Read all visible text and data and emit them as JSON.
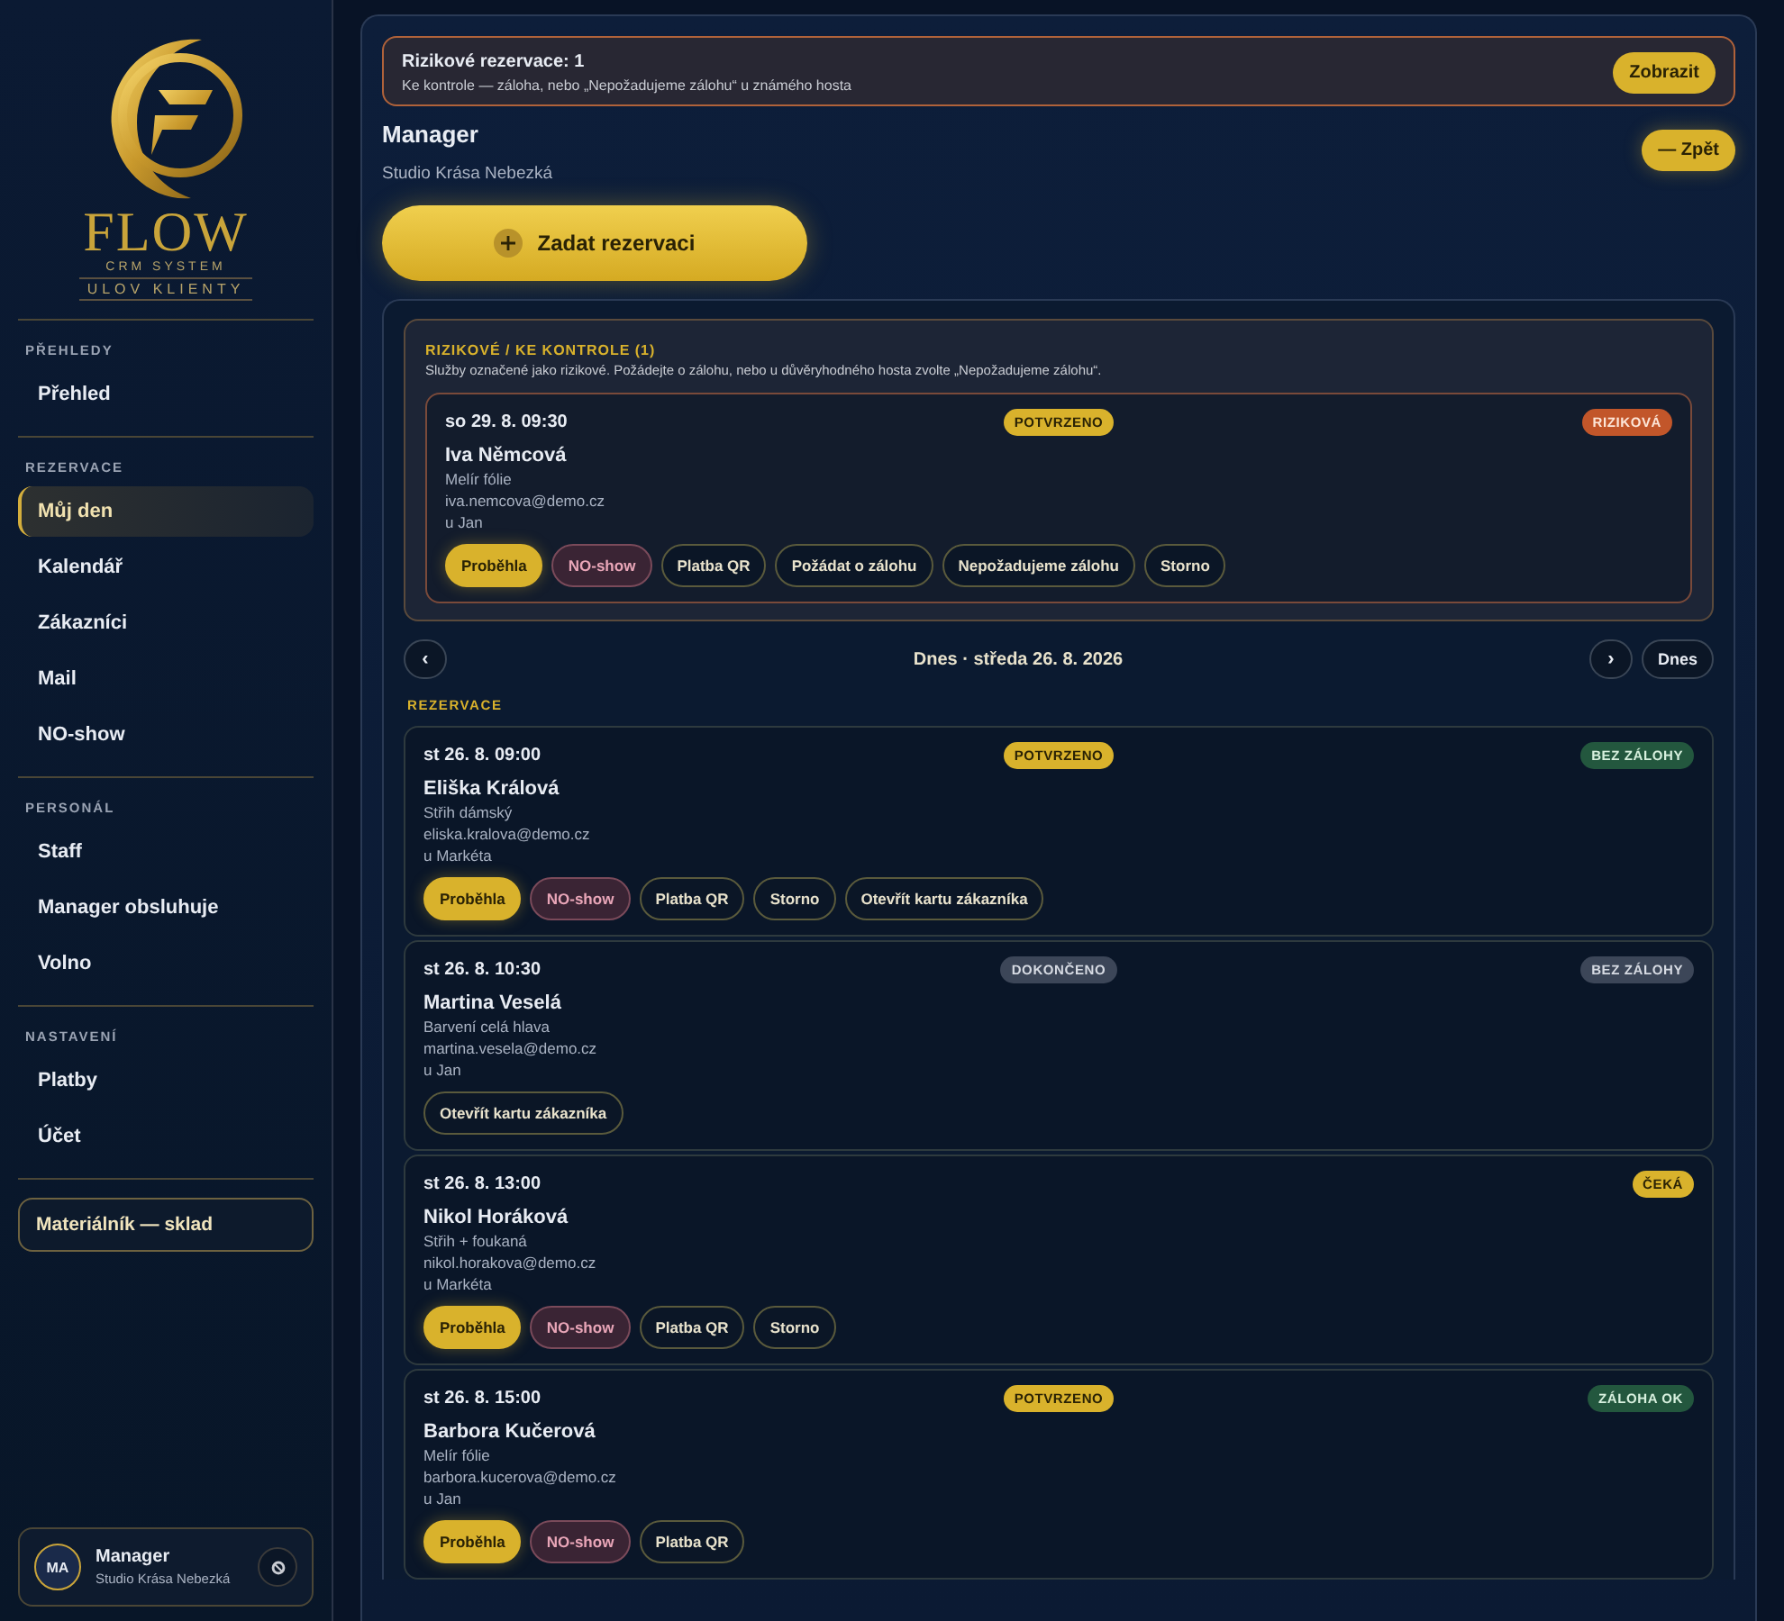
{
  "sidebar": {
    "logo": {
      "title": "FLOW",
      "subtitle": "CRM SYSTEM",
      "tagline": "ULOV KLIENTY"
    },
    "sections": [
      {
        "heading": "PŘEHLEDY",
        "items": [
          {
            "label": "Přehled",
            "selected": false
          }
        ]
      },
      {
        "heading": "REZERVACE",
        "items": [
          {
            "label": "Můj den",
            "selected": true
          },
          {
            "label": "Kalendář",
            "selected": false
          },
          {
            "label": "Zákazníci",
            "selected": false
          },
          {
            "label": "Mail",
            "selected": false
          },
          {
            "label": "NO-show",
            "selected": false
          }
        ]
      },
      {
        "heading": "PERSONÁL",
        "items": [
          {
            "label": "Staff",
            "selected": false
          },
          {
            "label": "Manager obsluhuje",
            "selected": false
          },
          {
            "label": "Volno",
            "selected": false
          }
        ]
      },
      {
        "heading": "NASTAVENÍ",
        "items": [
          {
            "label": "Platby",
            "selected": false
          },
          {
            "label": "Účet",
            "selected": false
          }
        ]
      }
    ],
    "footer_button": "Materiálník — sklad",
    "user": {
      "initials": "MA",
      "name": "Manager",
      "studio": "Studio Krása Nebezká"
    }
  },
  "main": {
    "alert": {
      "title": "Rizikové rezervace: 1",
      "text": "Ke kontrole — záloha, nebo „Nepožadujeme zálohu“ u známého hosta",
      "button": "Zobrazit"
    },
    "header": {
      "title": "Manager",
      "subtitle": "Studio Krása Nebezká",
      "back_button": "— Zpět"
    },
    "add_button": "Zadat rezervaci",
    "risky": {
      "heading": "RIZIKOVÉ / KE KONTROLE (1)",
      "text": "Služby označené jako rizikové. Požádejte o zálohu, nebo u důvěryhodného hosta zvolte „Nepožadujeme zálohu“.",
      "bookings": [
        {
          "datetime": "so 29. 8. 09:30",
          "status": {
            "label": "POTVRZENO",
            "kind": "confirmed"
          },
          "tag": {
            "label": "RIZIKOVÁ",
            "kind": "risk"
          },
          "name": "Iva Němcová",
          "service": "Melír fólie",
          "email": "iva.nemcova@demo.cz",
          "staff": "u Jan",
          "actions": [
            {
              "label": "Proběhla",
              "kind": "primary"
            },
            {
              "label": "NO-show",
              "kind": "danger"
            },
            {
              "label": "Platba QR",
              "kind": "outline"
            },
            {
              "label": "Požádat o zálohu",
              "kind": "outline"
            },
            {
              "label": "Nepožadujeme zálohu",
              "kind": "outline"
            },
            {
              "label": "Storno",
              "kind": "outline"
            }
          ]
        }
      ]
    },
    "date_nav": {
      "prev": "‹",
      "label": "Dnes · středa 26. 8. 2026",
      "next": "›",
      "today": "Dnes"
    },
    "section_label": "REZERVACE",
    "bookings": [
      {
        "datetime": "st 26. 8. 09:00",
        "status": {
          "label": "POTVRZENO",
          "kind": "confirmed"
        },
        "tag": {
          "label": "BEZ ZÁLOHY",
          "kind": "ok"
        },
        "name": "Eliška Králová",
        "service": "Střih dámský",
        "email": "eliska.kralova@demo.cz",
        "staff": "u Markéta",
        "actions": [
          {
            "label": "Proběhla",
            "kind": "primary"
          },
          {
            "label": "NO-show",
            "kind": "danger"
          },
          {
            "label": "Platba QR",
            "kind": "outline"
          },
          {
            "label": "Storno",
            "kind": "outline"
          },
          {
            "label": "Otevřít kartu zákazníka",
            "kind": "outline"
          }
        ]
      },
      {
        "datetime": "st 26. 8. 10:30",
        "status": {
          "label": "DOKONČENO",
          "kind": "done"
        },
        "tag": {
          "label": "BEZ ZÁLOHY",
          "kind": "muted"
        },
        "name": "Martina Veselá",
        "service": "Barvení celá hlava",
        "email": "martina.vesela@demo.cz",
        "staff": "u Jan",
        "actions": [
          {
            "label": "Otevřít kartu zákazníka",
            "kind": "outline"
          }
        ]
      },
      {
        "datetime": "st 26. 8. 13:00",
        "tag": {
          "label": "ČEKÁ",
          "kind": "pending"
        },
        "name": "Nikol Horáková",
        "service": "Střih + foukaná",
        "email": "nikol.horakova@demo.cz",
        "staff": "u Markéta",
        "actions": [
          {
            "label": "Proběhla",
            "kind": "primary"
          },
          {
            "label": "NO-show",
            "kind": "danger"
          },
          {
            "label": "Platba QR",
            "kind": "outline"
          },
          {
            "label": "Storno",
            "kind": "outline"
          }
        ]
      },
      {
        "datetime": "st 26. 8. 15:00",
        "status": {
          "label": "POTVRZENO",
          "kind": "confirmed"
        },
        "tag": {
          "label": "ZÁLOHA OK",
          "kind": "ok"
        },
        "name": "Barbora Kučerová",
        "service": "Melír fólie",
        "email": "barbora.kucerova@demo.cz",
        "staff": "u Jan",
        "actions": [
          {
            "label": "Proběhla",
            "kind": "primary"
          },
          {
            "label": "NO-show",
            "kind": "danger"
          },
          {
            "label": "Platba QR",
            "kind": "outline"
          }
        ]
      }
    ]
  }
}
